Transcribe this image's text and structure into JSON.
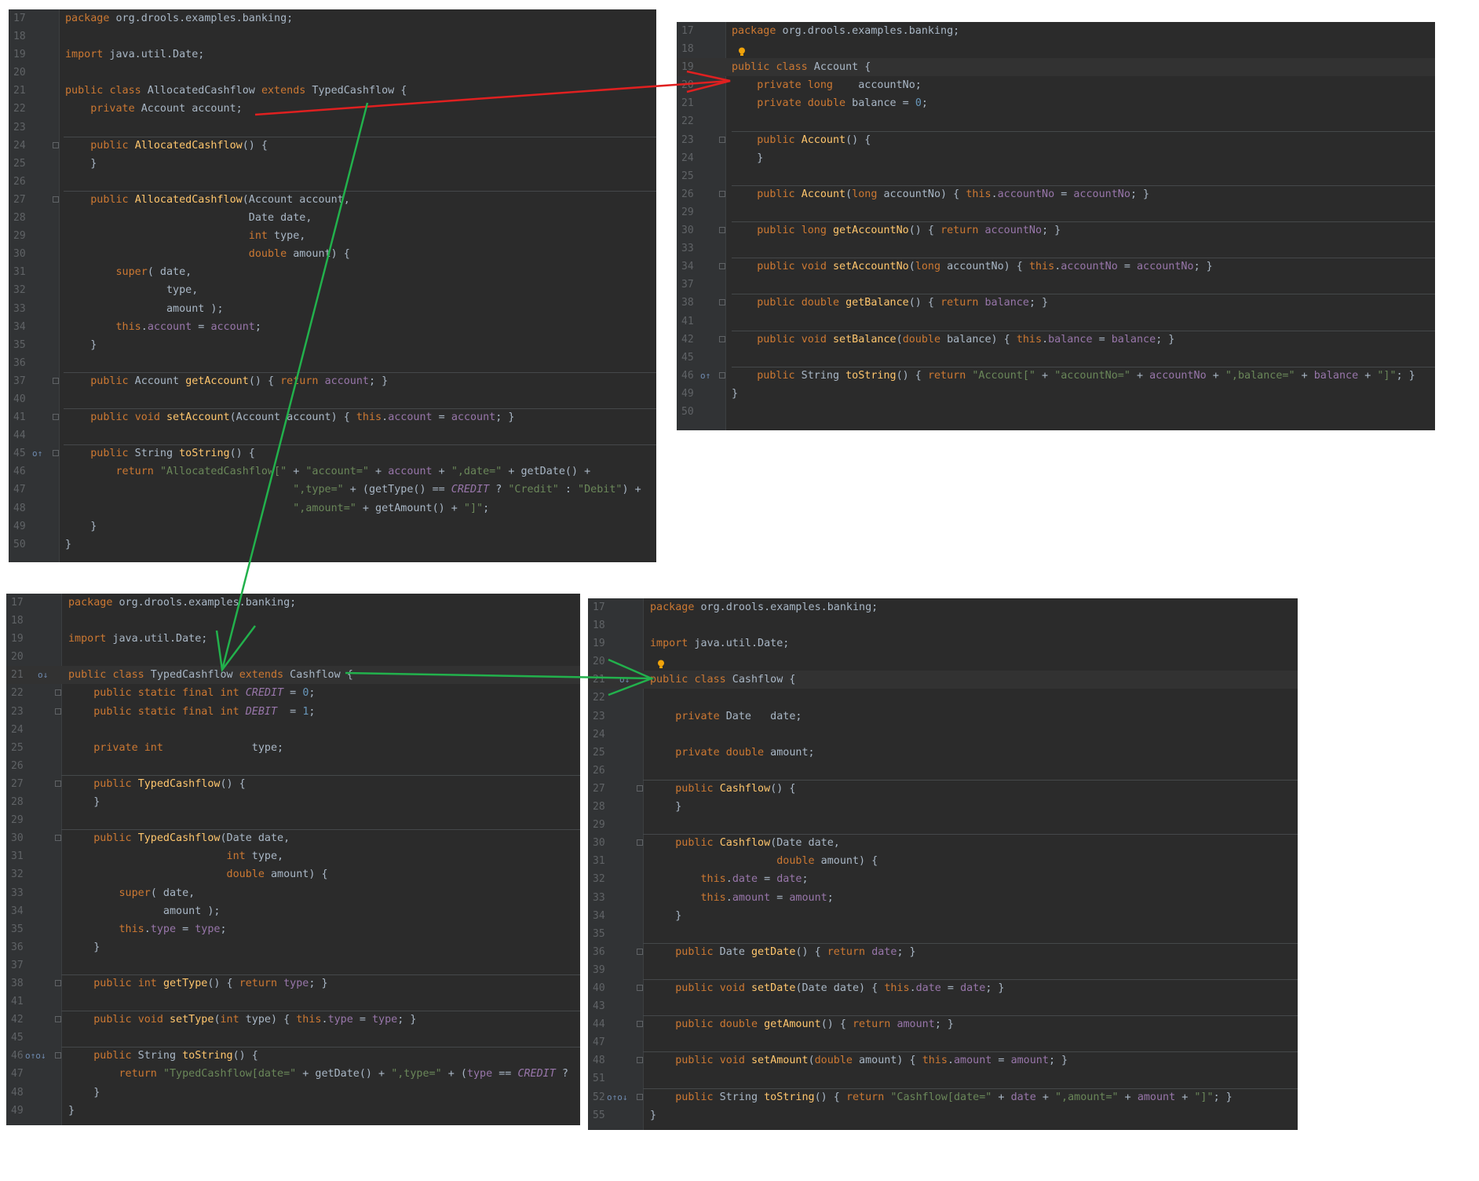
{
  "panels": [
    {
      "id": "allocated_cashflow",
      "lines": [
        {
          "n": "17",
          "t": "package org.drools.examples.banking;"
        },
        {
          "n": "18",
          "t": ""
        },
        {
          "n": "19",
          "t": "import java.util.Date;"
        },
        {
          "n": "20",
          "t": ""
        },
        {
          "n": "21",
          "t": "public class AllocatedCashflow extends TypedCashflow {"
        },
        {
          "n": "22",
          "t": "    private Account account;"
        },
        {
          "n": "23",
          "t": ""
        },
        {
          "n": "24",
          "t": "    public AllocatedCashflow() {"
        },
        {
          "n": "25",
          "t": "    }"
        },
        {
          "n": "26",
          "t": ""
        },
        {
          "n": "27",
          "t": "    public AllocatedCashflow(Account account,"
        },
        {
          "n": "28",
          "t": "                             Date date,"
        },
        {
          "n": "29",
          "t": "                             int type,"
        },
        {
          "n": "30",
          "t": "                             double amount) {"
        },
        {
          "n": "31",
          "t": "        super( date,"
        },
        {
          "n": "32",
          "t": "                type,"
        },
        {
          "n": "33",
          "t": "                amount );"
        },
        {
          "n": "34",
          "t": "        this.account = account;"
        },
        {
          "n": "35",
          "t": "    }"
        },
        {
          "n": "36",
          "t": ""
        },
        {
          "n": "37",
          "t": "    public Account getAccount() { return account; }"
        },
        {
          "n": "40",
          "t": ""
        },
        {
          "n": "41",
          "t": "    public void setAccount(Account account) { this.account = account; }"
        },
        {
          "n": "44",
          "t": ""
        },
        {
          "n": "45",
          "t": "    public String toString() {"
        },
        {
          "n": "46",
          "t": "        return \"AllocatedCashflow[\" + \"account=\" + account + \",date=\" + getDate() +"
        },
        {
          "n": "47",
          "t": "                                    \",type=\" + (getType() == CREDIT ? \"Credit\" : \"Debit\") +"
        },
        {
          "n": "48",
          "t": "                                    \",amount=\" + getAmount() + \"]\";"
        },
        {
          "n": "49",
          "t": "    }"
        },
        {
          "n": "50",
          "t": "}"
        }
      ]
    },
    {
      "id": "account",
      "lines": [
        {
          "n": "17",
          "t": "package org.drools.examples.banking;"
        },
        {
          "n": "18",
          "t": ""
        },
        {
          "n": "19",
          "t": "public class Account {"
        },
        {
          "n": "20",
          "t": "    private long    accountNo;"
        },
        {
          "n": "21",
          "t": "    private double balance = 0;"
        },
        {
          "n": "22",
          "t": ""
        },
        {
          "n": "23",
          "t": "    public Account() {"
        },
        {
          "n": "24",
          "t": "    }"
        },
        {
          "n": "25",
          "t": ""
        },
        {
          "n": "26",
          "t": "    public Account(long accountNo) { this.accountNo = accountNo; }"
        },
        {
          "n": "29",
          "t": ""
        },
        {
          "n": "30",
          "t": "    public long getAccountNo() { return accountNo; }"
        },
        {
          "n": "33",
          "t": ""
        },
        {
          "n": "34",
          "t": "    public void setAccountNo(long accountNo) { this.accountNo = accountNo; }"
        },
        {
          "n": "37",
          "t": ""
        },
        {
          "n": "38",
          "t": "    public double getBalance() { return balance; }"
        },
        {
          "n": "41",
          "t": ""
        },
        {
          "n": "42",
          "t": "    public void setBalance(double balance) { this.balance = balance; }"
        },
        {
          "n": "45",
          "t": ""
        },
        {
          "n": "46",
          "t": "    public String toString() { return \"Account[\" + \"accountNo=\" + accountNo + \",balance=\" + balance + \"]\"; }"
        },
        {
          "n": "49",
          "t": "}"
        },
        {
          "n": "50",
          "t": ""
        }
      ]
    },
    {
      "id": "typed_cashflow",
      "lines": [
        {
          "n": "17",
          "t": "package org.drools.examples.banking;"
        },
        {
          "n": "18",
          "t": ""
        },
        {
          "n": "19",
          "t": "import java.util.Date;"
        },
        {
          "n": "20",
          "t": ""
        },
        {
          "n": "21",
          "t": "public class TypedCashflow extends Cashflow {"
        },
        {
          "n": "22",
          "t": "    public static final int CREDIT = 0;"
        },
        {
          "n": "23",
          "t": "    public static final int DEBIT  = 1;"
        },
        {
          "n": "24",
          "t": ""
        },
        {
          "n": "25",
          "t": "    private int              type;"
        },
        {
          "n": "26",
          "t": ""
        },
        {
          "n": "27",
          "t": "    public TypedCashflow() {"
        },
        {
          "n": "28",
          "t": "    }"
        },
        {
          "n": "29",
          "t": ""
        },
        {
          "n": "30",
          "t": "    public TypedCashflow(Date date,"
        },
        {
          "n": "31",
          "t": "                         int type,"
        },
        {
          "n": "32",
          "t": "                         double amount) {"
        },
        {
          "n": "33",
          "t": "        super( date,"
        },
        {
          "n": "34",
          "t": "               amount );"
        },
        {
          "n": "35",
          "t": "        this.type = type;"
        },
        {
          "n": "36",
          "t": "    }"
        },
        {
          "n": "37",
          "t": ""
        },
        {
          "n": "38",
          "t": "    public int getType() { return type; }"
        },
        {
          "n": "41",
          "t": ""
        },
        {
          "n": "42",
          "t": "    public void setType(int type) { this.type = type; }"
        },
        {
          "n": "45",
          "t": ""
        },
        {
          "n": "46",
          "t": "    public String toString() {"
        },
        {
          "n": "47",
          "t": "        return \"TypedCashflow[date=\" + getDate() + \",type=\" + (type == CREDIT ?"
        },
        {
          "n": "48",
          "t": "    }"
        },
        {
          "n": "49",
          "t": "}"
        }
      ]
    },
    {
      "id": "cashflow",
      "lines": [
        {
          "n": "17",
          "t": "package org.drools.examples.banking;"
        },
        {
          "n": "18",
          "t": ""
        },
        {
          "n": "19",
          "t": "import java.util.Date;"
        },
        {
          "n": "20",
          "t": ""
        },
        {
          "n": "21",
          "t": "public class Cashflow {"
        },
        {
          "n": "22",
          "t": ""
        },
        {
          "n": "23",
          "t": "    private Date   date;"
        },
        {
          "n": "24",
          "t": ""
        },
        {
          "n": "25",
          "t": "    private double amount;"
        },
        {
          "n": "26",
          "t": ""
        },
        {
          "n": "27",
          "t": "    public Cashflow() {"
        },
        {
          "n": "28",
          "t": "    }"
        },
        {
          "n": "29",
          "t": ""
        },
        {
          "n": "30",
          "t": "    public Cashflow(Date date,"
        },
        {
          "n": "31",
          "t": "                    double amount) {"
        },
        {
          "n": "32",
          "t": "        this.date = date;"
        },
        {
          "n": "33",
          "t": "        this.amount = amount;"
        },
        {
          "n": "34",
          "t": "    }"
        },
        {
          "n": "35",
          "t": ""
        },
        {
          "n": "36",
          "t": "    public Date getDate() { return date; }"
        },
        {
          "n": "39",
          "t": ""
        },
        {
          "n": "40",
          "t": "    public void setDate(Date date) { this.date = date; }"
        },
        {
          "n": "43",
          "t": ""
        },
        {
          "n": "44",
          "t": "    public double getAmount() { return amount; }"
        },
        {
          "n": "47",
          "t": ""
        },
        {
          "n": "48",
          "t": "    public void setAmount(double amount) { this.amount = amount; }"
        },
        {
          "n": "51",
          "t": ""
        },
        {
          "n": "52",
          "t": "    public String toString() { return \"Cashflow[date=\" + date + \",amount=\" + amount + \"]\"; }"
        },
        {
          "n": "55",
          "t": "}"
        }
      ]
    }
  ],
  "colors": {
    "editor_bg": "#2b2b2b",
    "keyword": "#cc7832",
    "string": "#6a8759",
    "number": "#6897bb",
    "field": "#9876aa",
    "method": "#ffc66d",
    "text": "#a9b7c6",
    "arrow_account": "#e02020",
    "arrow_inherit": "#22b14c"
  }
}
